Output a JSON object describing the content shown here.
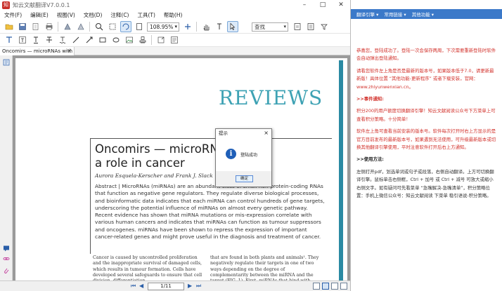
{
  "window": {
    "title": "知云文献翻译V7.0.0.1",
    "app_icon_glyph": "知"
  },
  "menu": {
    "items": [
      "文件(F)",
      "编辑(E)",
      "视图(V)",
      "文档(D)",
      "注释(C)",
      "工具(T)",
      "帮助(H)"
    ]
  },
  "toolbar": {
    "zoom": "108.95%",
    "search_placeholder": "查找"
  },
  "tab": {
    "label": "Oncomirs — microRNAs with",
    "close": "×"
  },
  "document": {
    "journal_header": "REVIEWS",
    "title_line1": "Oncomirs — microRN",
    "title_line2": "a role in cancer",
    "authors": "Aurora Esquela-Kerscher and Frank J. Slack",
    "abstract": "Abstract | MicroRNAs (miRNAs) are an abundant class of small non-protein-coding RNAs that function as negative gene regulators. They regulate diverse biological processes, and bioinformatic data indicates that each miRNA can control hundreds of gene targets, underscoring the potential influence of miRNAs on almost every genetic pathway. Recent evidence has shown that miRNA mutations or mis-expression correlate with various human cancers and indicates that miRNAs can function as tumour suppressors and oncogenes. miRNAs have been shown to repress the expression of important cancer-related genes and might prove useful in the diagnosis and treatment of cancer.",
    "col1": "Cancer is caused by uncontrolled proliferation and the inappropriate survival of damaged cells, which results in tumour formation. Cells have developed several safeguards to ensure that cell division, differentiation",
    "col2": "that are found in both plants and animals¹. They negatively regulate their targets in one of two ways depending on the degree of complementarity between the miRNA and the target (FIG. 1). First, miRNAs that bind with"
  },
  "dialog": {
    "title": "提示",
    "close": "×",
    "icon": "i",
    "message": "登陆成功",
    "ok": "确定"
  },
  "statusbar": {
    "page": "1/11"
  },
  "right_panel": {
    "tabs": [
      "翻译引擎 ▾",
      "常用链接 ▾",
      "其他功能 ▾"
    ],
    "p1": "恭喜您，登陆成功了。登陆一次会保存两周，下次需要重新登陆时软件会自动弹出登陆通知。",
    "p2": "请看您软件左上角是否是最新的版本号，如果版本低于7.0，请更新最新版！具体位置 “其他功能-更新程序” 或者下载安装，官网：www.zhiyunwenxian.cn。",
    "h1": ">>事件通知:",
    "p3": "积分200的用户额度切换翻译引擎！知云文献阅读公众号下方菜单上可查看积分策略。十分简单！",
    "p4": "软件左上角可查看当前安装的版本号。软件每次打开时右上方显示的是官方目前发布的最新版本号，如果遇到无法使用，可升级最新版本或切换其他翻译引擎使用，平时注意软件打开后右上方通知。",
    "h2": ">>使用方法:",
    "p5": "左侧打开pdf，划选单词或句子或段落，右侧自动翻译。上方可切换翻译引擎。鼠标单击右侧框，Ctrl + 加号 或 Ctrl + 减号 可放大或缩小右侧文字。如有疑问可先看菜单 “急嘴解决-急嘴清单”，积分策略位置：手机上微信公众号：知云文献阅读 下菜单 稳引语说-积分策略。"
  }
}
